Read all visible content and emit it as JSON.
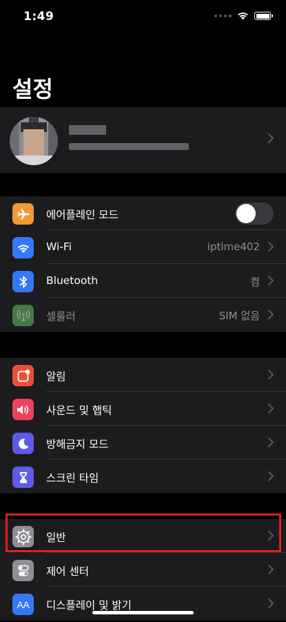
{
  "status_bar": {
    "time": "1:49"
  },
  "header": {
    "title": "설정"
  },
  "profile": {},
  "group1": [
    {
      "label": "에어플레인 모드",
      "icon": "airplane-icon",
      "color": "#f09a37",
      "toggle": false
    },
    {
      "label": "Wi-Fi",
      "value": "iptime402",
      "icon": "wifi-icon",
      "color": "#3478f6"
    },
    {
      "label": "Bluetooth",
      "value": "켬",
      "icon": "bluetooth-icon",
      "color": "#3478f6"
    },
    {
      "label": "셀룰러",
      "value": "SIM 없음",
      "icon": "cellular-icon",
      "color": "#65c466",
      "disabled": true
    }
  ],
  "group2": [
    {
      "label": "알림",
      "icon": "notifications-icon",
      "color": "#eb4e3d"
    },
    {
      "label": "사운드 및 햅틱",
      "icon": "sound-icon",
      "color": "#eb445a"
    },
    {
      "label": "방해금지 모드",
      "icon": "moon-icon",
      "color": "#5e5ce6"
    },
    {
      "label": "스크린 타임",
      "icon": "hourglass-icon",
      "color": "#5e5ce6"
    }
  ],
  "group3": [
    {
      "label": "일반",
      "icon": "gear-icon",
      "color": "#8e8e93",
      "highlighted": true
    },
    {
      "label": "제어 센터",
      "icon": "switches-icon",
      "color": "#8e8e93"
    },
    {
      "label": "디스플레이 및 밝기",
      "icon": "display-icon",
      "color": "#3478f6",
      "icon_text": "AA"
    }
  ]
}
